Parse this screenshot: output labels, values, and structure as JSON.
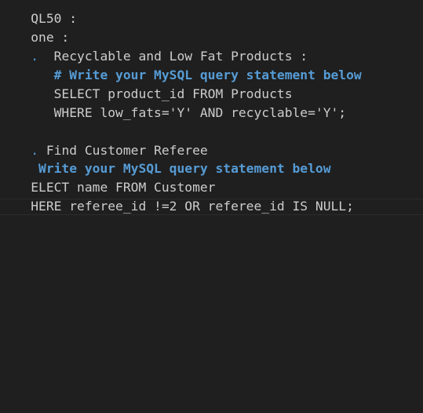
{
  "editor": {
    "lines": [
      {
        "text": "QL50 :"
      },
      {
        "text": "one :"
      },
      {
        "bullet": ".",
        "text": "  Recyclable and Low Fat Products :"
      },
      {
        "text": "   # Write your MySQL query statement below",
        "style": "comment"
      },
      {
        "text": "   SELECT product_id FROM Products"
      },
      {
        "text": "   WHERE low_fats='Y' AND recyclable='Y';"
      },
      {
        "text": ""
      },
      {
        "bullet": ".",
        "text": " Find Customer Referee"
      },
      {
        "text": " Write your MySQL query statement below",
        "style": "comment"
      },
      {
        "text": "ELECT name FROM Customer"
      },
      {
        "text": "HERE referee_id !=2 OR referee_id IS NULL;"
      }
    ]
  }
}
